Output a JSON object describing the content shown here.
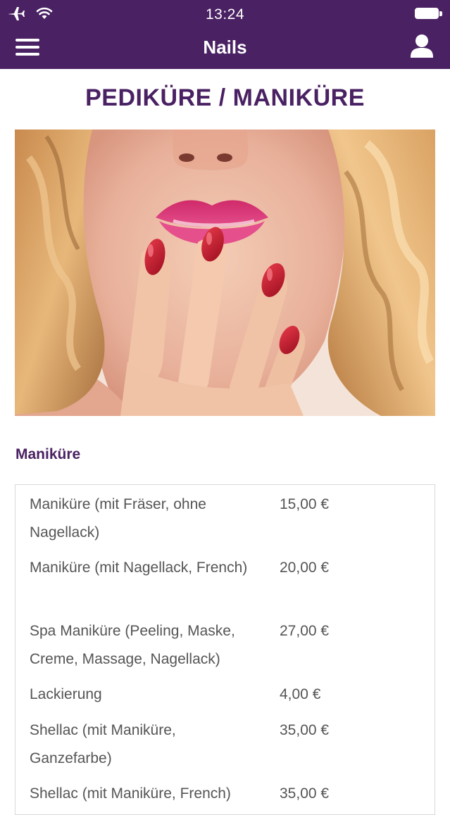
{
  "status_bar": {
    "time": "13:24",
    "icons": [
      "airplane-icon",
      "wifi-icon",
      "battery-icon"
    ]
  },
  "nav": {
    "title": "Nails",
    "menu_icon": "hamburger-menu-icon",
    "user_icon": "user-icon"
  },
  "page": {
    "title": "PEDIKÜRE / MANIKÜRE",
    "hero_image": "woman-lips-red-nails-photo"
  },
  "section": {
    "heading": "Maniküre"
  },
  "prices": [
    {
      "name": "Maniküre (mit Fräser, ohne Nagellack)",
      "price": "15,00 €"
    },
    {
      "name": "Maniküre (mit Nagellack, French)",
      "price": "20,00 €"
    },
    {
      "name": "Spa Maniküre (Peeling, Maske, Creme, Massage, Nagellack)",
      "price": "27,00 €"
    },
    {
      "name": "Lackierung",
      "price": "4,00 €"
    },
    {
      "name": "Shellac (mit Maniküre, Ganzefarbe)",
      "price": "35,00 €"
    },
    {
      "name": "Shellac (mit Maniküre, French)",
      "price": "35,00 €"
    }
  ],
  "colors": {
    "brand": "#4a2163",
    "text": "#555555",
    "border": "#d9d9d9"
  }
}
